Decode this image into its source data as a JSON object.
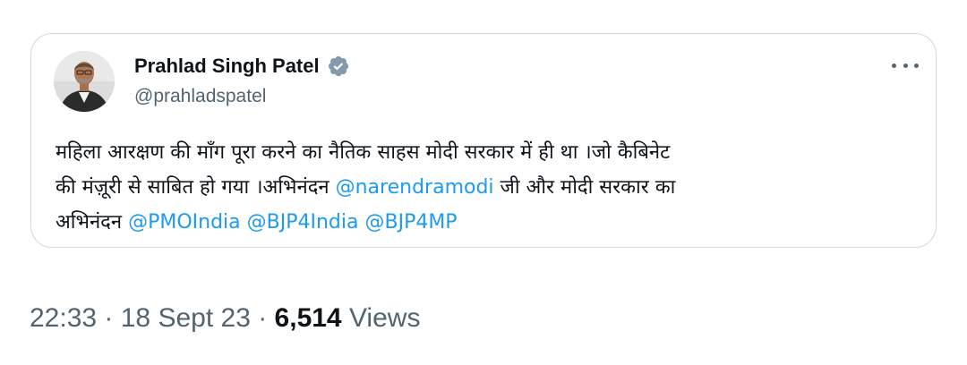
{
  "tweet": {
    "author": {
      "display_name": "Prahlad Singh Patel",
      "handle": "@prahladspatel",
      "verified": true,
      "avatar": "avatar-photo"
    },
    "more_icon": "ellipsis-icon",
    "text": {
      "line1": "महिला आरक्षण की माँग पूरा करने का नैतिक साहस मोदी सरकार में ही था ।जो कैबिनेट",
      "line2_prefix": "की मंज़ूरी से साबित हो गया ।अभिनंदन ",
      "line2_mention": "@narendramodi",
      "line2_suffix": " जी और मोदी सरकार का",
      "line3_prefix": "अभिनंदन ",
      "line3_mentions": [
        "@PMOIndia",
        "@BJP4India",
        "@BJP4MP"
      ]
    },
    "meta": {
      "time": "22:33",
      "separator": " · ",
      "date": "18 Sept 23",
      "views_count": "6,514",
      "views_label": " Views"
    }
  },
  "colors": {
    "link": "#1d9bf0",
    "verified_badge": "#829aab",
    "secondary_text": "#536471",
    "border": "#cfd9de"
  }
}
